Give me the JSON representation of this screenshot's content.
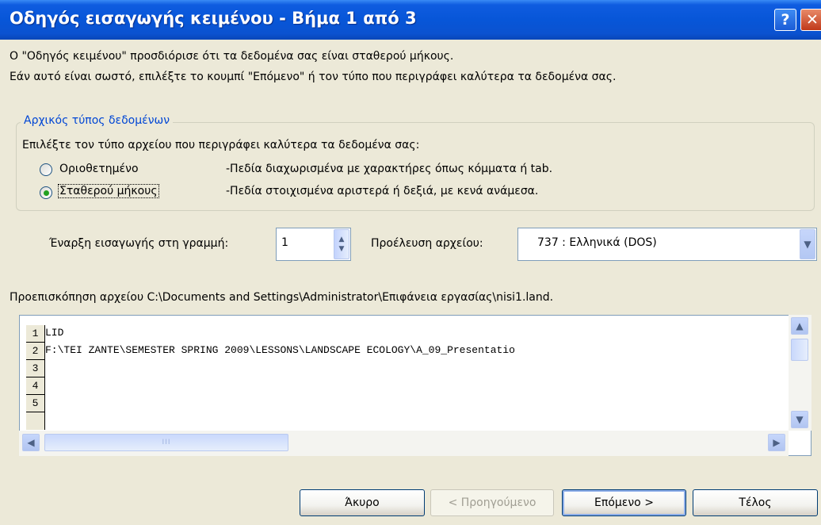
{
  "window": {
    "title": "Οδηγός εισαγωγής κειμένου - Βήμα 1 από 3",
    "help_label": "?",
    "close_label": "✕"
  },
  "intro": {
    "line1": "Ο \"Οδηγός κειμένου\" προσδιόρισε ότι τα δεδομένα σας είναι σταθερού μήκους.",
    "line2": "Εάν αυτό είναι σωστό, επιλέξτε το κουμπί \"Επόμενο\" ή τον τύπο που περιγράφει καλύτερα τα δεδομένα σας."
  },
  "data_type": {
    "legend": "Αρχικός τύπος δεδομένων",
    "description": "Επιλέξτε τον τύπο αρχείου που περιγράφει καλύτερα τα δεδομένα σας:",
    "options": [
      {
        "label": "Οριοθετημένο",
        "hint": "-Πεδία διαχωρισμένα με χαρακτήρες όπως κόμματα ή tab.",
        "selected": false
      },
      {
        "label": "Σταθερού μήκους",
        "hint": "-Πεδία στοιχισμένα αριστερά ή δεξιά, με κενά ανάμεσα.",
        "selected": true
      }
    ]
  },
  "import_start": {
    "label": "Έναρξη εισαγωγής στη γραμμή:",
    "value": "1"
  },
  "file_origin": {
    "label": "Προέλευση αρχείου:",
    "value": "737 : Ελληνικά (DOS)"
  },
  "preview": {
    "label": "Προεπισκόπηση αρχείου C:\\Documents and Settings\\Administrator\\Επιφάνεια εργασίας\\nisi1.land.",
    "line_numbers": [
      "1",
      "2",
      "3",
      "4",
      "5"
    ],
    "lines": [
      "LID",
      "F:\\TEI ZANTE\\SEMESTER SPRING 2009\\LESSONS\\LANDSCAPE ECOLOGY\\A_09_Presentatio",
      "",
      "",
      ""
    ]
  },
  "buttons": {
    "cancel": "Άκυρο",
    "back": "< Προηγούμενο",
    "next": "Επόμενο >",
    "finish": "Τέλος"
  },
  "icons": {
    "scroll_up": "▲",
    "scroll_down": "▼",
    "scroll_left": "◀",
    "scroll_right": "▶",
    "dropdown": "▼",
    "spin_up": "▲",
    "spin_down": "▼",
    "grip": "III"
  }
}
